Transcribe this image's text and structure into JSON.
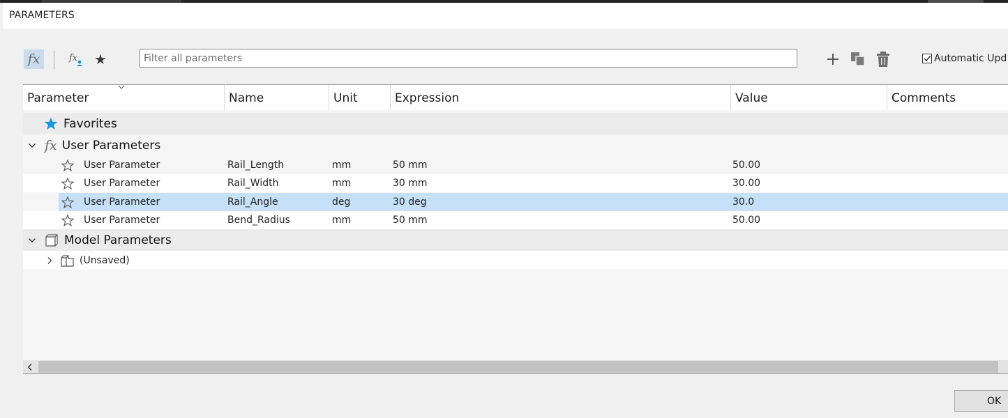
{
  "window": {
    "title": "PARAMETERS"
  },
  "toolbar": {
    "all_params_icon": "fx-icon",
    "user_params_icon": "user-fx-icon",
    "favorites_icon": "star-icon",
    "add_icon": "plus-icon",
    "copy_icon": "copy-icon",
    "delete_icon": "trash-icon",
    "accent_color": "#c9dced"
  },
  "filter": {
    "placeholder": "Filter all parameters",
    "value": ""
  },
  "auto_update": {
    "label": "Automatic Upd",
    "checked": true
  },
  "columns": [
    "Parameter",
    "Name",
    "Unit",
    "Expression",
    "Value",
    "Comments"
  ],
  "groups": {
    "favorites": {
      "label": "Favorites",
      "icon": "star-icon",
      "color": "#1b96d6"
    },
    "user": {
      "label": "User Parameters",
      "icon": "fx-icon",
      "expanded": true,
      "rows": [
        {
          "parameter": "User Parameter",
          "name": "Rail_Length",
          "unit": "mm",
          "expression": "50 mm",
          "value": "50.00",
          "comments": "",
          "selected": false
        },
        {
          "parameter": "User Parameter",
          "name": "Rail_Width",
          "unit": "mm",
          "expression": "30 mm",
          "value": "30.00",
          "comments": "",
          "selected": false
        },
        {
          "parameter": "User Parameter",
          "name": "Rail_Angle",
          "unit": "deg",
          "expression": "30 deg",
          "value": "30.0",
          "comments": "",
          "selected": true
        },
        {
          "parameter": "User Parameter",
          "name": "Bend_Radius",
          "unit": "mm",
          "expression": "50 mm",
          "value": "50.00",
          "comments": "",
          "selected": false
        }
      ]
    },
    "model": {
      "label": "Model Parameters",
      "icon": "cube-icon",
      "expanded": true,
      "children": [
        {
          "label": "(Unsaved)",
          "icon": "component-icon",
          "expanded": false
        }
      ]
    }
  },
  "selection_color": "#c5e0f7",
  "buttons": {
    "ok": "OK"
  }
}
